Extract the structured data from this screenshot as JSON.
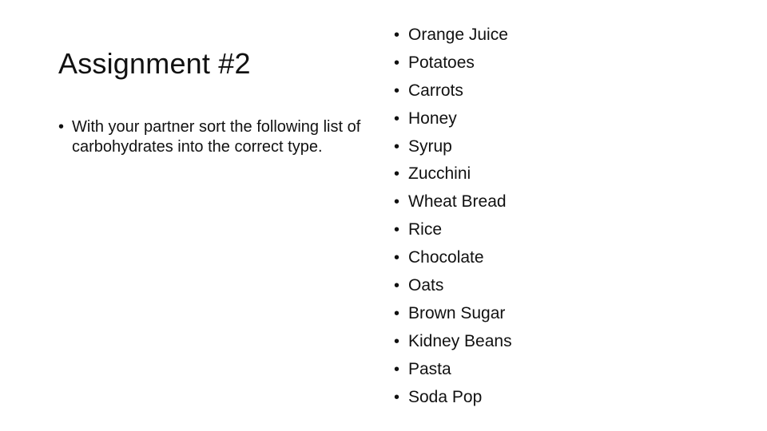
{
  "slide": {
    "title": "Assignment #2",
    "instructions": [
      "With your partner sort the following list of carbohydrates into the correct type."
    ],
    "bullet_glyph": "•",
    "items": [
      "Orange Juice",
      "Potatoes",
      "Carrots",
      "Honey",
      "Syrup",
      "Zucchini",
      "Wheat Bread",
      "Rice",
      "Chocolate",
      "Oats",
      "Brown Sugar",
      "Kidney Beans",
      "Pasta",
      "Soda Pop"
    ]
  }
}
